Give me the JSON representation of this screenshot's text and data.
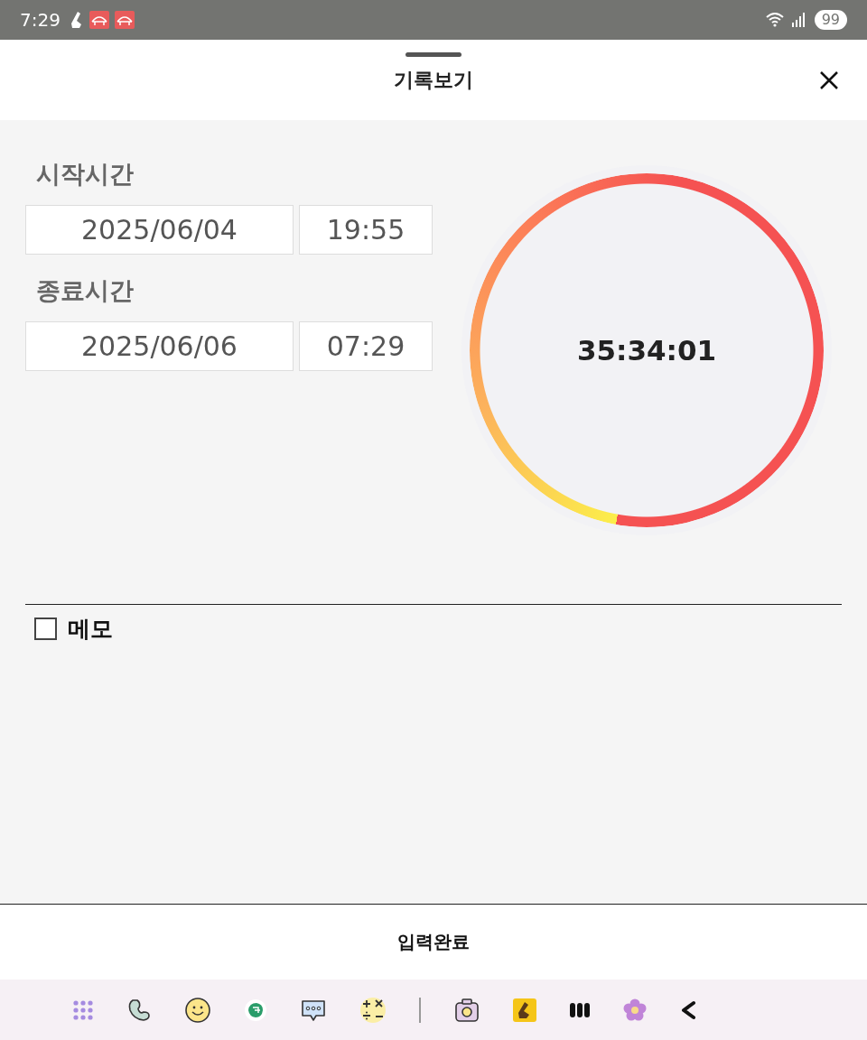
{
  "status_bar": {
    "time": "7:29",
    "battery": "99"
  },
  "header": {
    "title": "기록보기"
  },
  "start": {
    "label": "시작시간",
    "date": "2025/06/04",
    "time": "19:55"
  },
  "end": {
    "label": "종료시간",
    "date": "2025/06/06",
    "time": "07:29"
  },
  "timer": {
    "elapsed": "35:34:01"
  },
  "memo": {
    "label": "메모",
    "checked": false
  },
  "submit_button": "입력완료"
}
